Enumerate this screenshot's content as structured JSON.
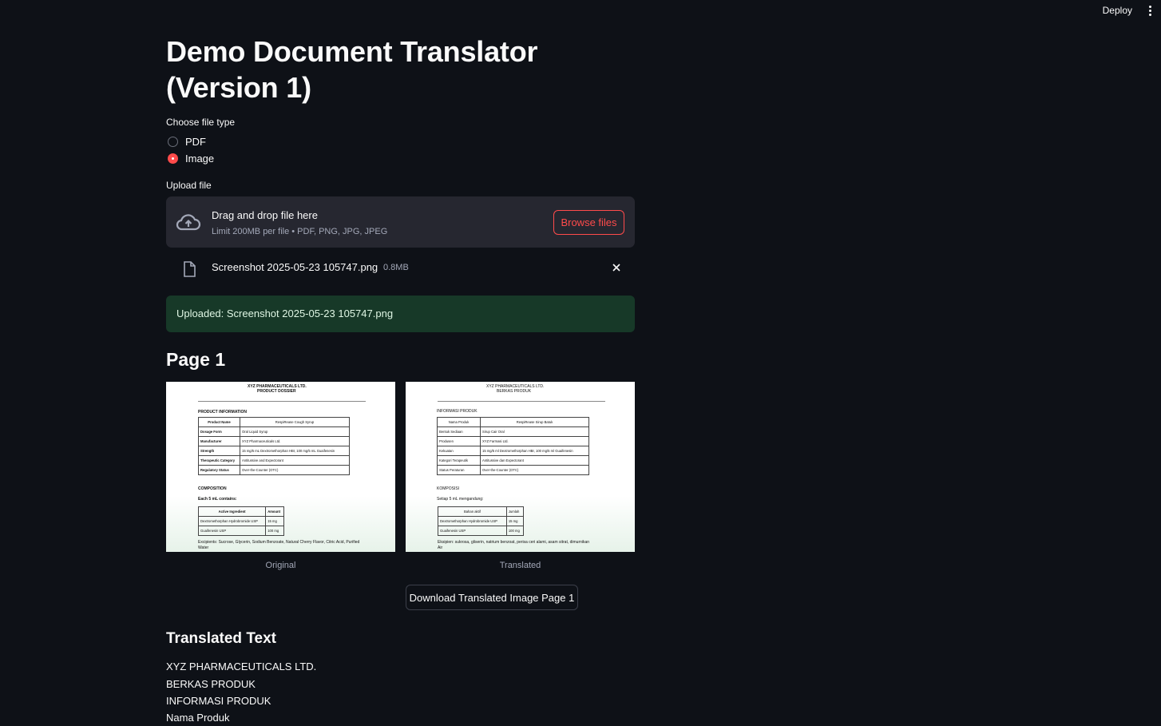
{
  "header": {
    "deploy_label": "Deploy",
    "menu_icon": "kebab-icon"
  },
  "title": "Demo Document Translator (Version 1)",
  "file_type": {
    "label": "Choose file type",
    "options": [
      "PDF",
      "Image"
    ],
    "selected": "Image"
  },
  "upload": {
    "label": "Upload file",
    "drop_text": "Drag and drop file here",
    "limit_text": "Limit 200MB per file • PDF, PNG, JPG, JPEG",
    "browse_label": "Browse files",
    "file_name": "Screenshot 2025-05-23 105747.png",
    "file_size": "0.8MB"
  },
  "success_message": "Uploaded: Screenshot 2025-05-23 105747.png",
  "page_heading": "Page 1",
  "original_caption": "Original",
  "translated_caption": "Translated",
  "download_label": "Download Translated Image Page 1",
  "translated_text": {
    "heading": "Translated Text",
    "lines": [
      "XYZ PHARMACEUTICALS LTD.",
      "BERKAS PRODUK",
      "INFORMASI PRODUK",
      "Nama Produk"
    ]
  },
  "original_doc": {
    "company": "XYZ PHARMACEUTICALS LTD.",
    "subtitle": "PRODUCT DOSSIER",
    "section1": "PRODUCT INFORMATION",
    "rows": [
      [
        "Product Name",
        "RespiRease Cough Syrup"
      ],
      [
        "Dosage Form",
        "Oral Liquid Syrup"
      ],
      [
        "Manufacturer",
        "XYZ Pharmaceuticals Ltd."
      ],
      [
        "Strength",
        "15 mg/5 mL Dextromethorphan HBr, 100 mg/5 mL Guaifenesin"
      ],
      [
        "Therapeutic Category",
        "Antitussive and Expectorant"
      ],
      [
        "Regulatory Status",
        "Over-the-Counter (OTC)"
      ]
    ],
    "section2": "COMPOSITION",
    "each_note": "Each 5 mL contains:",
    "comp_header": [
      "Active Ingredient",
      "Amount"
    ],
    "comp_rows": [
      [
        "Dextromethorphan Hydrobromide USP",
        "15 mg"
      ],
      [
        "Guaifenesin USP",
        "100 mg"
      ]
    ],
    "excipients": "Excipients: Sucrose, Glycerin, Sodium Benzoate, Natural Cherry Flavor, Citric Acid, Purified",
    "excipients2": "Water"
  },
  "translated_doc": {
    "company": "XYZ PHARMACEUTICALS LTD.",
    "subtitle": "BERKAS PRODUK",
    "section1": "INFORMASI PRODUK",
    "rows": [
      [
        "Nama Produk",
        "RespiRease Sirup Batuk"
      ],
      [
        "Bentuk Sediaan",
        "Sirup Cair Oral"
      ],
      [
        "Produsen",
        "XYZ Farmasi Ltd."
      ],
      [
        "Kekuatan",
        "15 mg/5 ml Dextromethorphan HBr, 100 mg/5 ml Guaifenesin"
      ],
      [
        "Kategori Terapeutik",
        "Antitussive dan Expectorant"
      ],
      [
        "Status Peraturan",
        "Over-the-Counter (OTC)"
      ]
    ],
    "section2": "KOMPOSISI",
    "each_note": "Setiap 5 mL mengandung:",
    "comp_header": [
      "Bahan aktif",
      "Jumlah"
    ],
    "comp_rows": [
      [
        "Dextromethorphan Hydrobromide USP",
        "15 mg"
      ],
      [
        "Guaifenesin USP",
        "100 mg"
      ]
    ],
    "excipients": "Eksipien: sukrosa, gliserin, natrium benzoat, perisa ceri alami, asam sitrat, dimurnikan",
    "excipients2": "Air"
  }
}
